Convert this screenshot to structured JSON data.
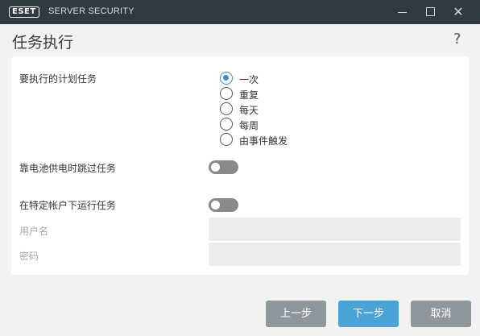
{
  "titlebar": {
    "logo_text": "ESET",
    "product": "SERVER SECURITY"
  },
  "page": {
    "title": "任务执行",
    "help": "?"
  },
  "schedule": {
    "label": "要执行的计划任务",
    "options": [
      "一次",
      "重复",
      "每天",
      "每周",
      "由事件触发"
    ],
    "selected": "一次"
  },
  "battery": {
    "label": "靠电池供电时跳过任务",
    "enabled": false
  },
  "run_as": {
    "label": "在特定帐户下运行任务",
    "enabled": false,
    "username_label": "用户名",
    "username_value": "",
    "password_label": "密码",
    "password_value": ""
  },
  "buttons": {
    "back": "上一步",
    "next": "下一步",
    "cancel": "取消"
  },
  "colors": {
    "titlebar": "#2f3a41",
    "accent": "#3d8fc0",
    "primary_button": "#4aa3d6",
    "secondary_button": "#8e979c"
  }
}
